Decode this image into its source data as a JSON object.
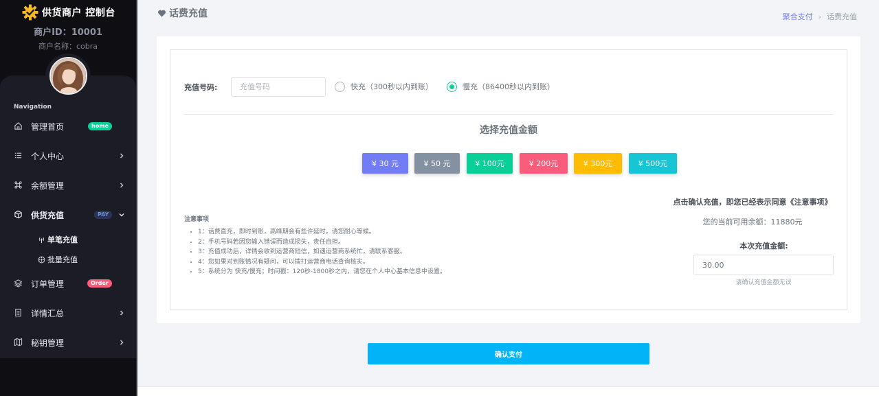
{
  "brand": {
    "title": "供货商户 控制台"
  },
  "merchant": {
    "id_text": "商户ID：10001",
    "name_text": "商户名称：cobra"
  },
  "nav": {
    "title": "Navigation",
    "items": [
      {
        "label": "管理首页",
        "icon": "home-icon",
        "badge": "home"
      },
      {
        "label": "个人中心",
        "icon": "list-icon"
      },
      {
        "label": "余额管理",
        "icon": "command-icon"
      },
      {
        "label": "供货充值",
        "icon": "box-icon",
        "badge": "PAY"
      },
      {
        "label": "订单管理",
        "icon": "layers-icon",
        "badge": "Order"
      },
      {
        "label": "详情汇总",
        "icon": "document-icon"
      },
      {
        "label": "秘钥管理",
        "icon": "map-icon"
      }
    ],
    "sub_items": [
      {
        "label": "单笔充值",
        "icon": "antenna-icon"
      },
      {
        "label": "批量充值",
        "icon": "dial-icon"
      }
    ]
  },
  "page": {
    "title": "话费充值",
    "breadcrumb": {
      "parent": "聚合支付",
      "current": "话费充值"
    }
  },
  "form": {
    "phone_label": "充值号码:",
    "phone_placeholder": "充值号码",
    "radio_fast": "快充（300秒以内到账）",
    "radio_slow": "慢充（86400秒以内到账）",
    "selected_mode": "slow",
    "select_title": "选择充值金额",
    "amounts": [
      {
        "label": "¥ 30 元",
        "color": "#727cf5"
      },
      {
        "label": "¥ 50 元",
        "color": "#8391a2"
      },
      {
        "label": "¥ 100元",
        "color": "#0acf97"
      },
      {
        "label": "¥ 200元",
        "color": "#fa5c7c"
      },
      {
        "label": "¥ 300元",
        "color": "#ffbc00"
      },
      {
        "label": "¥ 500元",
        "color": "#17c5d5"
      }
    ]
  },
  "notice": {
    "title": "注意事项",
    "items": [
      "1：话费直充，即时到账，高峰期会有些许延时，请您耐心等候。",
      "2：手机号码若因您输入错误而造成损失，责任自担。",
      "3：充值成功后，详情会收到运营商短信，如遇运营商系统忙，请联系客服。",
      "4：您如果对到账情况有疑问，可以拨打运营商电话查询核实。",
      "5：系统分为 快充/慢充；时间戳：120秒-1800秒之内，请您在个人中心基本信息中设置。"
    ]
  },
  "summary": {
    "confirm_text": "点击确认充值，即您已经表示同意《注意事项》",
    "balance_text": "您的当前可用余额：11880元",
    "amount_label": "本次充值金额:",
    "amount_value": "30.00",
    "amount_hint": "请确认充值金额无误"
  },
  "pay_button": "确认支付",
  "colors": {
    "accent": "#727cf5",
    "success": "#0acf97",
    "primary_button": "#00b4f7",
    "sidebar_bg": "#0f0f13"
  }
}
